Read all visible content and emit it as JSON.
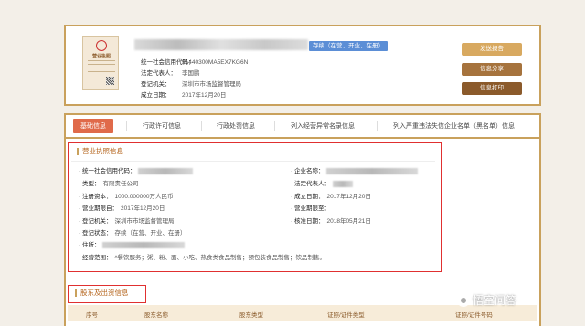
{
  "header": {
    "status_tag": "存续（在营、开业、在册）",
    "license_title": "营业执照",
    "fields": [
      {
        "label": "统一社会信用代码：",
        "value": "91440300MA5EX7KG6N"
      },
      {
        "label": "法定代表人：",
        "value": "李国鹏"
      },
      {
        "label": "登记机关：",
        "value": "深圳市市场监督管理局"
      },
      {
        "label": "成立日期：",
        "value": "2017年12月20日"
      }
    ],
    "buttons": {
      "report": "发送报告",
      "share": "信息分享",
      "print": "信息打印"
    }
  },
  "tabs": [
    "基础信息",
    "行政许可信息",
    "行政处罚信息",
    "列入经营异常名录信息",
    "列入严重违法失信企业名单（黑名单）信息"
  ],
  "business_license": {
    "title": "营业执照信息",
    "left": [
      {
        "label": "· 统一社会信用代码：",
        "value": ""
      },
      {
        "label": "· 类型：",
        "value": "有限责任公司"
      },
      {
        "label": "· 注册资本：",
        "value": "1000.000000万人民币"
      },
      {
        "label": "· 营业期限自：",
        "value": "2017年12月20日"
      },
      {
        "label": "· 登记机关：",
        "value": "深圳市市场监督管理局"
      },
      {
        "label": "· 登记状态：",
        "value": "存续（在营、开业、在册）"
      },
      {
        "label": "· 住所：",
        "value": ""
      },
      {
        "label": "· 经营范围：",
        "value": "^餐饮服务；粥、粉、面、小吃、热食类食品制售；预包装食品制售；饮品制售。"
      }
    ],
    "right": [
      {
        "label": "· 企业名称：",
        "value": ""
      },
      {
        "label": "· 法定代表人：",
        "value": ""
      },
      {
        "label": "· 成立日期：",
        "value": "2017年12月20日"
      },
      {
        "label": "· 营业期限至：",
        "value": ""
      },
      {
        "label": "· 核准日期：",
        "value": "2018年05月21日"
      }
    ]
  },
  "shareholders": {
    "title": "股东及出资信息",
    "columns": [
      "序号",
      "股东名称",
      "股东类型",
      "证照/证件类型",
      "证照/证件号码"
    ]
  },
  "watermark": "悟空问答"
}
